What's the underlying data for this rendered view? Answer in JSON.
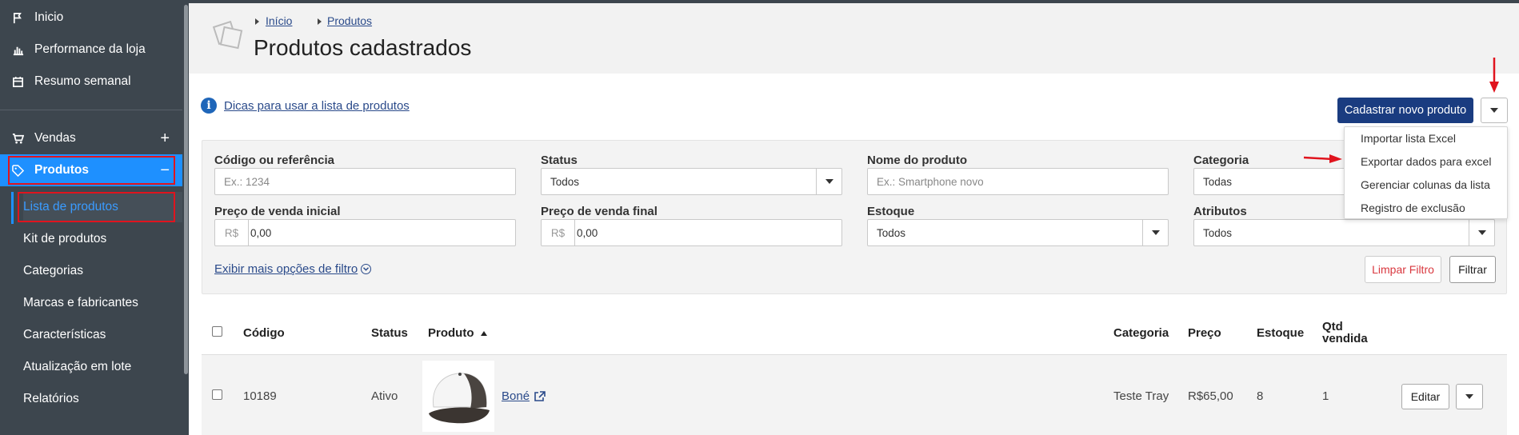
{
  "sidebar": {
    "items": [
      {
        "label": "Inicio",
        "icon": "flag-icon"
      },
      {
        "label": "Performance da loja",
        "icon": "bar-chart-icon"
      },
      {
        "label": "Resumo semanal",
        "icon": "calendar-icon"
      },
      {
        "label": "Vendas",
        "icon": "cart-icon",
        "expand": "+"
      },
      {
        "label": "Produtos",
        "icon": "tag-icon",
        "expand": "−"
      }
    ],
    "subitems": [
      {
        "label": "Lista de produtos"
      },
      {
        "label": "Kit de produtos"
      },
      {
        "label": "Categorias"
      },
      {
        "label": "Marcas e fabricantes"
      },
      {
        "label": "Características"
      },
      {
        "label": "Atualização em lote"
      },
      {
        "label": "Relatórios"
      }
    ]
  },
  "header": {
    "breadcrumb": [
      "Início",
      "Produtos"
    ],
    "title": "Produtos cadastrados"
  },
  "actions": {
    "tips_link": "Dicas para usar a lista de produtos",
    "new_product": "Cadastrar novo produto",
    "menu": [
      "Importar lista Excel",
      "Exportar dados para excel",
      "Gerenciar colunas da lista",
      "Registro de exclusão"
    ]
  },
  "filters": {
    "code_label": "Código ou referência",
    "code_placeholder": "Ex.: 1234",
    "status_label": "Status",
    "status_value": "Todos",
    "name_label": "Nome do produto",
    "name_placeholder": "Ex.: Smartphone novo",
    "category_label": "Categoria",
    "category_value": "Todas",
    "price_start_label": "Preço de venda inicial",
    "price_end_label": "Preço de venda final",
    "currency": "R$",
    "price_start_value": "0,00",
    "price_end_value": "0,00",
    "stock_label": "Estoque",
    "stock_value": "Todos",
    "attributes_label": "Atributos",
    "attributes_value": "Todos",
    "more_options": "Exibir mais opções de filtro",
    "clear_button": "Limpar Filtro",
    "filter_button": "Filtrar"
  },
  "table": {
    "headers": {
      "code": "Código",
      "status": "Status",
      "product": "Produto",
      "category": "Categoria",
      "price": "Preço",
      "stock": "Estoque",
      "qty_sold_1": "Qtd",
      "qty_sold_2": "vendida"
    },
    "rows": [
      {
        "code": "10189",
        "status": "Ativo",
        "product": "Boné",
        "category": "Teste Tray",
        "price": "R$65,00",
        "stock": "8",
        "qty_sold": "1",
        "edit": "Editar"
      }
    ]
  },
  "colors": {
    "sidebar_bg": "#3d464e",
    "active_bg": "#1e90ff",
    "primary_button": "#1a3c80",
    "annotation_red": "#e0141e"
  }
}
